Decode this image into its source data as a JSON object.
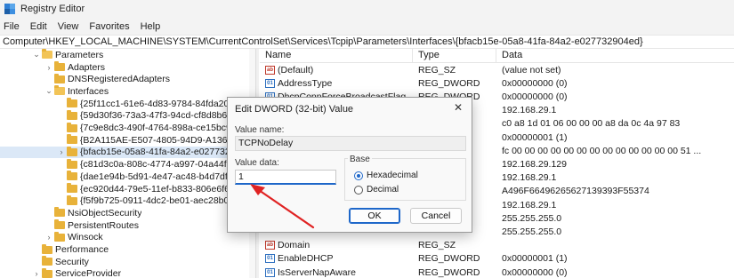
{
  "window": {
    "title": "Registry Editor"
  },
  "menu": [
    "File",
    "Edit",
    "View",
    "Favorites",
    "Help"
  ],
  "address": "Computer\\HKEY_LOCAL_MACHINE\\SYSTEM\\CurrentControlSet\\Services\\Tcpip\\Parameters\\Interfaces\\{bfacb15e-05a8-41fa-84a2-e027732904ed}",
  "tree": {
    "items": [
      {
        "label": "Parameters"
      },
      {
        "label": "Adapters"
      },
      {
        "label": "DNSRegisteredAdapters"
      },
      {
        "label": "Interfaces"
      },
      {
        "label": "{25f11cc1-61e6-4d83-9784-84fda208737"
      },
      {
        "label": "{59d30f36-73a3-47f3-94cd-cf8d8b69173"
      },
      {
        "label": "{7c9e8dc3-490f-4764-898a-ce15bc96149"
      },
      {
        "label": "{B2A115AE-E507-4805-94D9-A136FBFC3"
      },
      {
        "label": "{bfacb15e-05a8-41fa-84a2-e027732904e"
      },
      {
        "label": "{c81d3c0a-808c-4774-a997-04a44fe32f8"
      },
      {
        "label": "{dae1e94b-5d91-4e47-ac48-b4d7df81a4"
      },
      {
        "label": "{ec920d44-79e5-11ef-b833-806e6f6e696"
      },
      {
        "label": "{f5f9b725-0911-4dc2-be01-aec28b01f83"
      },
      {
        "label": "NsiObjectSecurity"
      },
      {
        "label": "PersistentRoutes"
      },
      {
        "label": "Winsock"
      },
      {
        "label": "Performance"
      },
      {
        "label": "Security"
      },
      {
        "label": "ServiceProvider"
      }
    ]
  },
  "values_list": {
    "headers": {
      "name": "Name",
      "type": "Type",
      "data": "Data"
    },
    "rows": [
      {
        "name": "(Default)",
        "type": "REG_SZ",
        "data": "(value not set)",
        "icon": "string"
      },
      {
        "name": "AddressType",
        "type": "REG_DWORD",
        "data": "0x00000000 (0)",
        "icon": "dword"
      },
      {
        "name": "DhcpConnForceBroadcastFlag",
        "type": "REG_DWORD",
        "data": "0x00000000 (0)",
        "icon": "dword"
      },
      {
        "name": "",
        "type": "",
        "data": "192.168.29.1",
        "icon": ""
      },
      {
        "name": "",
        "type": "",
        "data": "c0 a8 1d 01 06 00 00 00 a8 da 0c 4a 97 83",
        "icon": ""
      },
      {
        "name": "",
        "type": "",
        "data": "0x00000001 (1)",
        "icon": ""
      },
      {
        "name": "",
        "type": "",
        "data": "fc 00 00 00 00 00 00 00 00 00 00 00 00 00 51 ...",
        "icon": ""
      },
      {
        "name": "",
        "type": "",
        "data": "192.168.29.129",
        "icon": ""
      },
      {
        "name": "",
        "type": "",
        "data": "192.168.29.1",
        "icon": ""
      },
      {
        "name": "",
        "type": "",
        "data": "A496F66496265627139393F55374",
        "icon": ""
      },
      {
        "name": "",
        "type": "",
        "data": "192.168.29.1",
        "icon": ""
      },
      {
        "name": "",
        "type": "",
        "data": "255.255.255.0",
        "icon": ""
      },
      {
        "name": "",
        "type": "",
        "data": "255.255.255.0",
        "icon": ""
      },
      {
        "name": "Domain",
        "type": "REG_SZ",
        "data": "",
        "icon": "string"
      },
      {
        "name": "EnableDHCP",
        "type": "REG_DWORD",
        "data": "0x00000001 (1)",
        "icon": "dword"
      },
      {
        "name": "IsServerNapAware",
        "type": "REG_DWORD",
        "data": "0x00000000 (0)",
        "icon": "dword"
      }
    ]
  },
  "dialog": {
    "title": "Edit DWORD (32-bit) Value",
    "value_name_label": "Value name:",
    "value_name": "TCPNoDelay",
    "value_data_label": "Value data:",
    "value_data": "1",
    "base_label": "Base",
    "hex_label": "Hexadecimal",
    "dec_label": "Decimal",
    "ok_label": "OK",
    "cancel_label": "Cancel",
    "close_glyph": "✕"
  },
  "colors": {
    "accent": "#1e67c9",
    "arrow": "#e02323",
    "selection": "#dbe8f7"
  }
}
